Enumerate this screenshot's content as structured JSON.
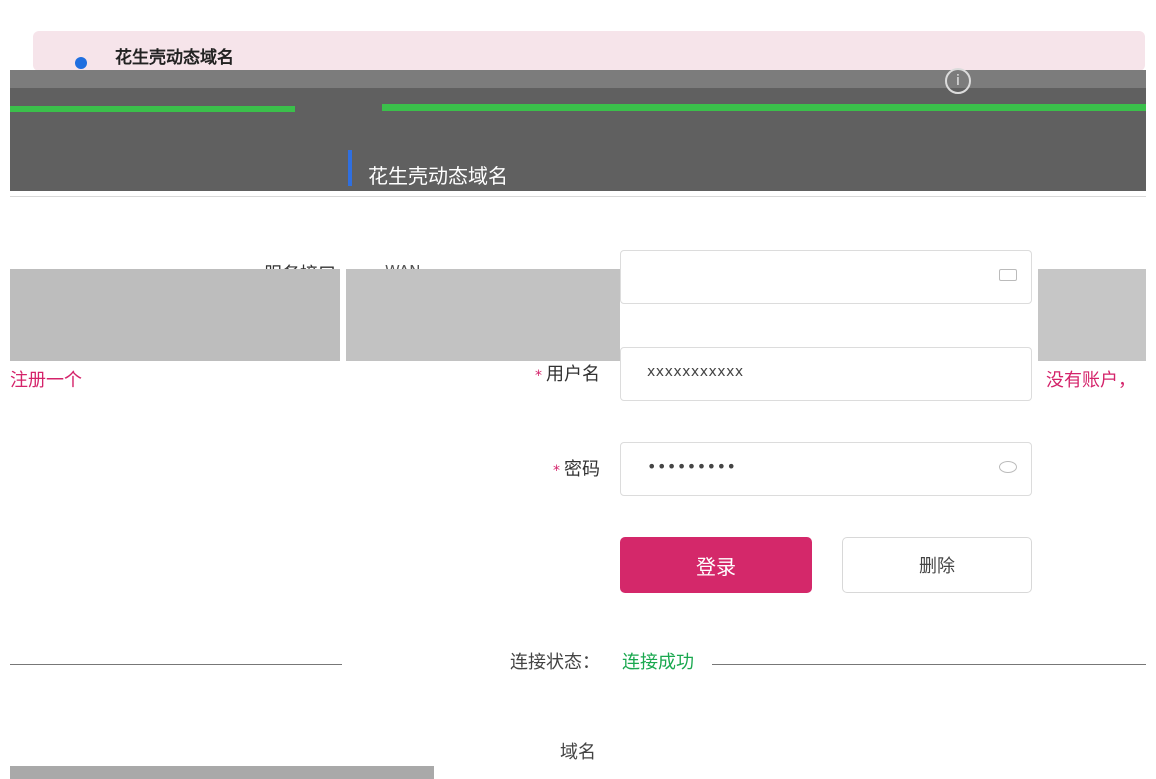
{
  "header": {
    "card_title": "花生壳动态域名",
    "section_title": "花生壳动态域名"
  },
  "form": {
    "service_label": "服务接口",
    "service_value": "WAN",
    "username_label": "用户名",
    "username_value": "xxxxxxxxxxx",
    "password_label": "密码",
    "password_value": "•••••••••",
    "register_link_left": "注册一个",
    "register_link_right": "没有账户，",
    "login_button": "登录",
    "delete_button": "删除",
    "status_label": "连接状态：",
    "status_value": "连接成功",
    "domain_label": "域名"
  },
  "colors": {
    "accent": "#d4286a",
    "success": "#1aa84f",
    "brand_blue": "#1f6fe0"
  }
}
